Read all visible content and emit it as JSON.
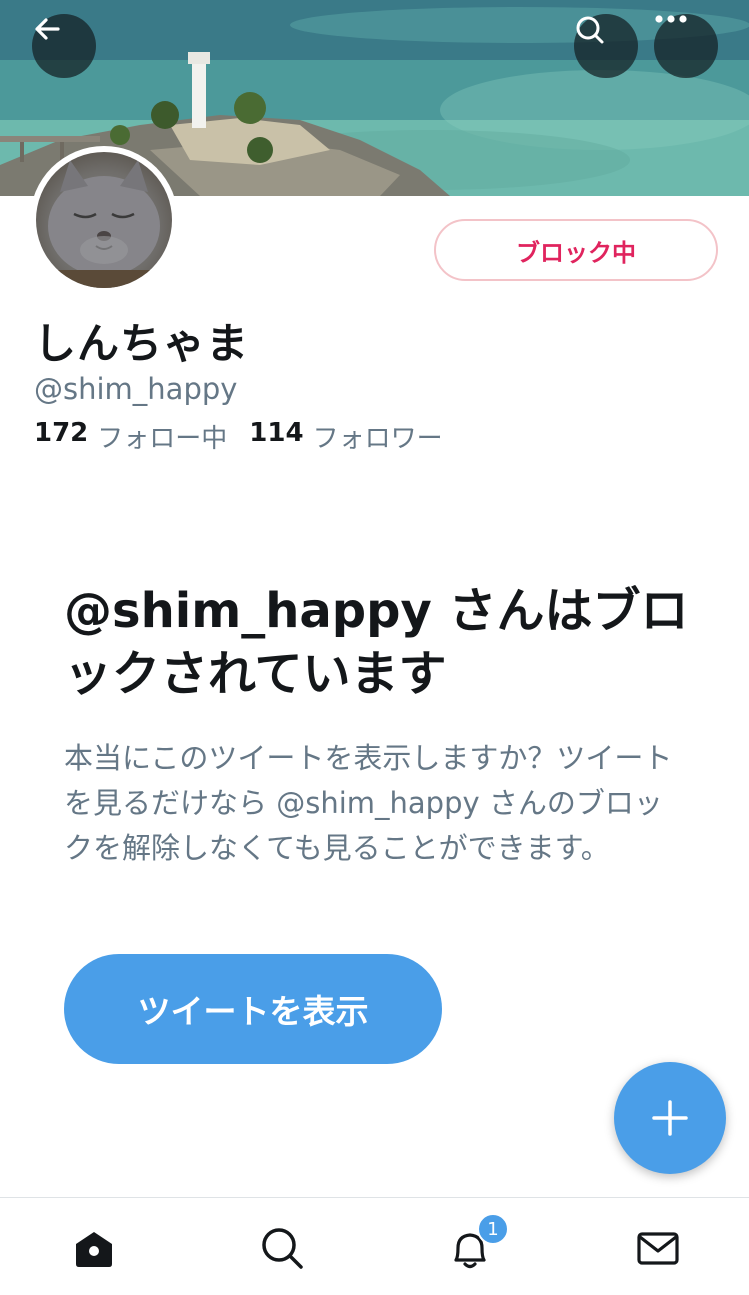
{
  "profile": {
    "display_name": "しんちゃま",
    "handle": "@shim_happy",
    "blocked_label": "ブロック中",
    "following_count": "172",
    "following_label": "フォロー中",
    "followers_count": "114",
    "followers_label": "フォロワー"
  },
  "blocked_notice": {
    "title": "@shim_happy さんはブロックされています",
    "description": "本当にこのツイートを表示しますか？ツイートを見るだけなら @shim_happy さんのブロックを解除しなくても見ることができます。",
    "show_button_label": "ツイートを表示"
  },
  "header": {
    "back_icon": "back-arrow-icon",
    "search_icon": "search-icon",
    "more_icon": "more-icon"
  },
  "tabbar": {
    "items": [
      {
        "icon": "home-icon"
      },
      {
        "icon": "search-icon"
      },
      {
        "icon": "bell-icon"
      },
      {
        "icon": "mail-icon"
      }
    ],
    "notification_badge": "1"
  },
  "colors": {
    "accent": "#4a9ee8",
    "blocked_red": "#e0245e",
    "text_primary": "#14171a",
    "text_secondary": "#657786"
  }
}
